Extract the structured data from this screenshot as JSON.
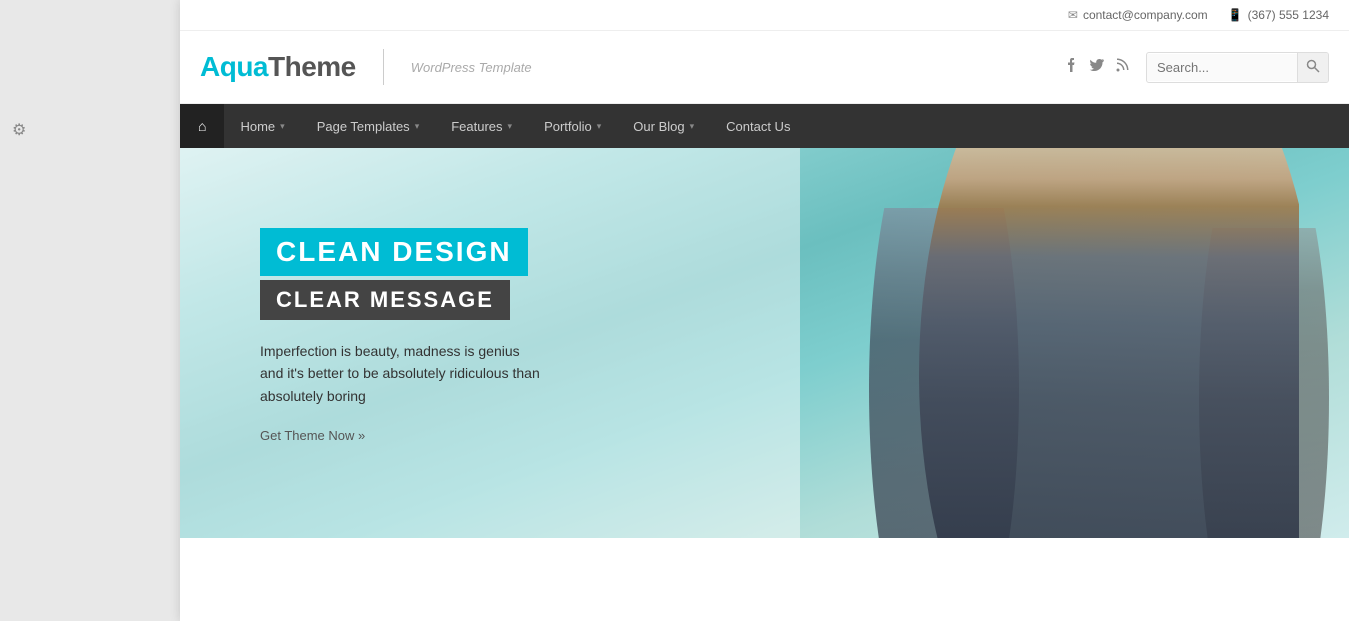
{
  "settings": {
    "gear_symbol": "⚙"
  },
  "topbar": {
    "email_icon": "✉",
    "email": "contact@company.com",
    "phone_icon": "📱",
    "phone": "(367) 555 1234"
  },
  "header": {
    "logo_aqua": "Aqua",
    "logo_theme": "Theme",
    "tagline": "WordPress Template",
    "search_placeholder": "Search..."
  },
  "social": {
    "facebook": "f",
    "twitter": "t",
    "rss": "r"
  },
  "nav": {
    "home_symbol": "⌂",
    "items": [
      {
        "label": "Home",
        "has_arrow": true
      },
      {
        "label": "Page Templates",
        "has_arrow": true
      },
      {
        "label": "Features",
        "has_arrow": true
      },
      {
        "label": "Portfolio",
        "has_arrow": true
      },
      {
        "label": "Our Blog",
        "has_arrow": true
      },
      {
        "label": "Contact Us",
        "has_arrow": false
      }
    ]
  },
  "hero": {
    "title1": "CLEAN DESIGN",
    "title2": "CLEAR MESSAGE",
    "description": "Imperfection is beauty, madness is genius and it's better to be absolutely ridiculous than absolutely boring",
    "cta": "Get Theme Now »"
  }
}
